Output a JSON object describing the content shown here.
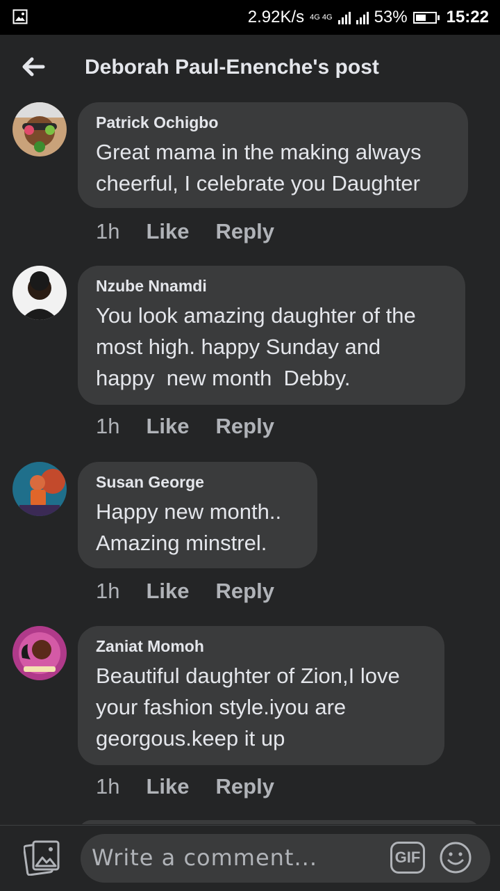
{
  "status_bar": {
    "speed": "2.92K/s",
    "network_top": "4G 4G",
    "battery": "53%",
    "battery_level": 0.53,
    "time": "15:22",
    "icons": [
      "image-icon",
      "signal-icon",
      "battery-icon"
    ]
  },
  "header": {
    "title": "Deborah Paul-Enenche's post",
    "back_icon": "arrow-left-icon"
  },
  "comments": [
    {
      "author": "Patrick Ochigbo",
      "lines": [
        "Great mama in the making always",
        "cheerful, I celebrate you Daughter"
      ],
      "time": "1h",
      "like": "Like",
      "reply": "Reply"
    },
    {
      "author": "Nzube Nnamdi",
      "lines": [
        "You look amazing daughter of the",
        "most high. happy Sunday and",
        "happy  new month  Debby."
      ],
      "time": "1h",
      "like": "Like",
      "reply": "Reply"
    },
    {
      "author": "Susan George",
      "lines": [
        "Happy new month..",
        "Amazing minstrel."
      ],
      "time": "1h",
      "like": "Like",
      "reply": "Reply"
    },
    {
      "author": "Zaniat Momoh",
      "lines": [
        "Beautiful daughter of Zion,I love",
        "your fashion style.iyou are",
        "georgous.keep it up"
      ],
      "time": "1h",
      "like": "Like",
      "reply": "Reply"
    }
  ],
  "composer": {
    "placeholder": "Write a comment...",
    "gif_label": "GIF",
    "photo_icon": "photo-icon",
    "emoji_icon": "emoji-icon"
  },
  "colors": {
    "background": "#242526",
    "bubble": "#3a3b3c",
    "text": "#e4e6eb",
    "secondary": "#b0b3b8"
  }
}
